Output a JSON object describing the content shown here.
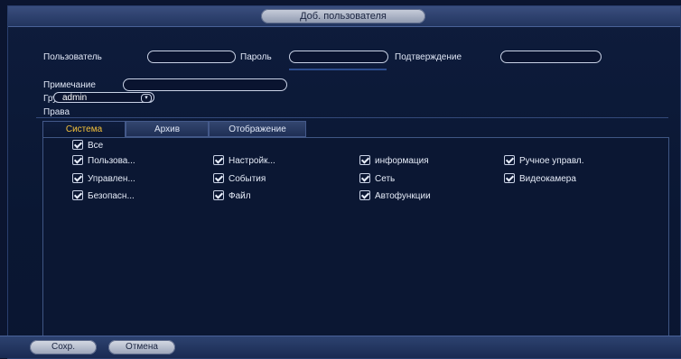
{
  "title": "Доб. пользователя",
  "form": {
    "user_label": "Пользователь",
    "user_value": "",
    "password_label": "Пароль",
    "password_value": "",
    "confirm_label": "Подтверждение",
    "confirm_value": "",
    "note_label": "Примечание",
    "note_value": "",
    "group_label": "Группа",
    "group_value": "admin",
    "rights_label": "Права"
  },
  "tabs": [
    {
      "label": "Система",
      "active": true
    },
    {
      "label": "Архив",
      "active": false
    },
    {
      "label": "Отображение",
      "active": false
    }
  ],
  "permissions": {
    "all": {
      "label": "Все",
      "checked": true
    },
    "items": [
      {
        "label": "Пользова...",
        "checked": true
      },
      {
        "label": "Настройк...",
        "checked": true
      },
      {
        "label": "информация",
        "checked": true
      },
      {
        "label": "Ручное управл.",
        "checked": true
      },
      {
        "label": "Управлен...",
        "checked": true
      },
      {
        "label": "События",
        "checked": true
      },
      {
        "label": "Сеть",
        "checked": true
      },
      {
        "label": "Видеокамера",
        "checked": true
      },
      {
        "label": "Безопасн...",
        "checked": true
      },
      {
        "label": "Файл",
        "checked": true
      },
      {
        "label": "Автофункции",
        "checked": true
      }
    ]
  },
  "buttons": {
    "save": "Сохр.",
    "cancel": "Отмена"
  },
  "colors": {
    "accent_tab": "#f3c03a",
    "background": "#0b1530"
  }
}
